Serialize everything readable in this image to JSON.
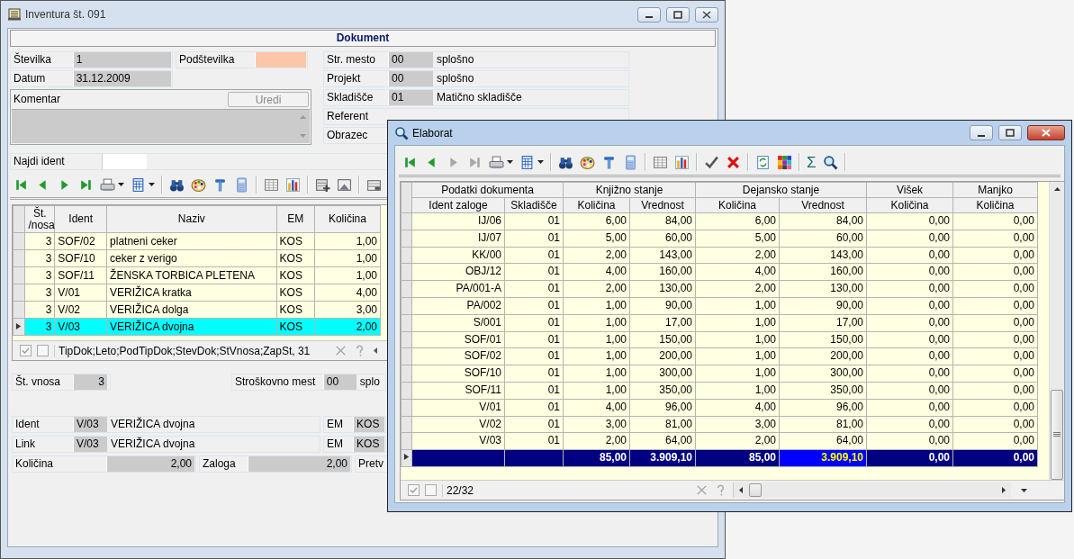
{
  "main_window": {
    "title": "Inventura št. 091",
    "header": "Dokument",
    "number": {
      "label": "Številka",
      "value": "1"
    },
    "subnumber": {
      "label": "Podštevilka"
    },
    "date": {
      "label": "Datum",
      "value": "31.12.2009"
    },
    "comment": {
      "label": "Komentar",
      "button": "Uredi"
    },
    "side_fields": [
      {
        "label": "Str. mesto",
        "code": "00",
        "name": "splošno"
      },
      {
        "label": "Projekt",
        "code": "00",
        "name": "splošno"
      },
      {
        "label": "Skladišče",
        "code": "01",
        "name": "Matično skladišče"
      },
      {
        "label": "Referent"
      },
      {
        "label": "Obrazec"
      }
    ],
    "find": {
      "label": "Najdi ident"
    },
    "nav_buttons": [
      {
        "disabled": false
      },
      {
        "disabled": false
      },
      {
        "disabled": false
      },
      {
        "disabled": false
      }
    ],
    "table": {
      "columns": [
        "Št.\n/nosa",
        "Ident",
        "Naziv",
        "EM",
        "Količina"
      ],
      "rows": [
        {
          "entry": "3",
          "ident": "SOF/02",
          "name": "platneni ceker",
          "unit": "KOS",
          "qty": "1,00",
          "selected": false
        },
        {
          "entry": "3",
          "ident": "SOF/10",
          "name": "ceker z verigo",
          "unit": "KOS",
          "qty": "1,00",
          "selected": false
        },
        {
          "entry": "3",
          "ident": "SOF/11",
          "name": "ŽENSKA TORBICA PLETENA",
          "unit": "KOS",
          "qty": "1,00",
          "selected": false
        },
        {
          "entry": "3",
          "ident": "V/01",
          "name": "VERIŽICA kratka",
          "unit": "KOS",
          "qty": "4,00",
          "selected": false
        },
        {
          "entry": "3",
          "ident": "V/02",
          "name": "VERIŽICA dolga",
          "unit": "KOS",
          "qty": "3,00",
          "selected": false
        },
        {
          "entry": "3",
          "ident": "V/03",
          "name": "VERIŽICA dvojna",
          "unit": "KOS",
          "qty": "2,00",
          "selected": true
        }
      ]
    },
    "status": {
      "checks": [
        {
          "checked": true
        },
        {
          "checked": false
        }
      ],
      "text": "TipDok;Leto;PodTipDok;StevDok;StVnosa;ZapSt, 31"
    },
    "entry_no": {
      "label": "Št. vnosa",
      "value": "3"
    },
    "cost_center": {
      "label": "Stroškovno mest",
      "code": "00",
      "name": "splo"
    },
    "ident": {
      "label": "Ident",
      "code": "V/03",
      "name": "VERIŽICA dvojna",
      "unit_label": "EM",
      "unit": "KOS"
    },
    "link": {
      "label": "Link",
      "code": "V/03",
      "name": "VERIŽICA dvojna",
      "unit_label": "EM",
      "unit": "KOS"
    },
    "quantity": {
      "label": "Količina",
      "value": "2,00"
    },
    "stock": {
      "label": "Zaloga",
      "value": "2,00"
    },
    "conversion": {
      "label": "Pretv"
    }
  },
  "elaborat_window": {
    "title": "Elaborat",
    "nav_buttons": [
      {
        "disabled": false
      },
      {
        "disabled": false
      },
      {
        "disabled": true
      },
      {
        "disabled": true
      }
    ],
    "sum_glyph": "Σ",
    "table": {
      "groups": [
        {
          "label": "Podatki dokumenta",
          "columns": [
            "Ident zaloge",
            "Skladišče"
          ]
        },
        {
          "label": "Knjižno stanje",
          "columns": [
            "Količina",
            "Vrednost"
          ]
        },
        {
          "label": "Dejansko stanje",
          "columns": [
            "Količina",
            "Vrednost"
          ]
        },
        {
          "label": "Višek",
          "columns": [
            "Količina"
          ]
        },
        {
          "label": "Manjko",
          "columns": [
            "Količina"
          ]
        }
      ],
      "rows": [
        [
          "IJ/06",
          "01",
          "6,00",
          "84,00",
          "6,00",
          "84,00",
          "0,00",
          "0,00"
        ],
        [
          "IJ/07",
          "01",
          "5,00",
          "60,00",
          "5,00",
          "60,00",
          "0,00",
          "0,00"
        ],
        [
          "KK/00",
          "01",
          "2,00",
          "143,00",
          "2,00",
          "143,00",
          "0,00",
          "0,00"
        ],
        [
          "OBJ/12",
          "01",
          "4,00",
          "160,00",
          "4,00",
          "160,00",
          "0,00",
          "0,00"
        ],
        [
          "PA/001-A",
          "01",
          "2,00",
          "130,00",
          "2,00",
          "130,00",
          "0,00",
          "0,00"
        ],
        [
          "PA/002",
          "01",
          "1,00",
          "90,00",
          "1,00",
          "90,00",
          "0,00",
          "0,00"
        ],
        [
          "S/001",
          "01",
          "1,00",
          "17,00",
          "1,00",
          "17,00",
          "0,00",
          "0,00"
        ],
        [
          "SOF/01",
          "01",
          "1,00",
          "150,00",
          "1,00",
          "150,00",
          "0,00",
          "0,00"
        ],
        [
          "SOF/02",
          "01",
          "1,00",
          "200,00",
          "1,00",
          "200,00",
          "0,00",
          "0,00"
        ],
        [
          "SOF/10",
          "01",
          "1,00",
          "300,00",
          "1,00",
          "300,00",
          "0,00",
          "0,00"
        ],
        [
          "SOF/11",
          "01",
          "1,00",
          "350,00",
          "1,00",
          "350,00",
          "0,00",
          "0,00"
        ],
        [
          "V/01",
          "01",
          "4,00",
          "96,00",
          "4,00",
          "96,00",
          "0,00",
          "0,00"
        ],
        [
          "V/02",
          "01",
          "3,00",
          "81,00",
          "3,00",
          "81,00",
          "0,00",
          "0,00"
        ],
        [
          "V/03",
          "01",
          "2,00",
          "64,00",
          "2,00",
          "64,00",
          "0,00",
          "0,00"
        ]
      ],
      "totals": {
        "current": true,
        "cells": [
          {
            "value": "85,00",
            "selected": false
          },
          {
            "value": "3.909,10",
            "selected": false
          },
          {
            "value": "85,00",
            "selected": false
          },
          {
            "value": "3.909,10",
            "selected": true
          },
          {
            "value": "0,00",
            "selected": false
          },
          {
            "value": "0,00",
            "selected": false
          }
        ]
      }
    },
    "status": {
      "checks": [
        {
          "checked": true
        },
        {
          "checked": false
        }
      ],
      "counter": "22/32"
    }
  }
}
